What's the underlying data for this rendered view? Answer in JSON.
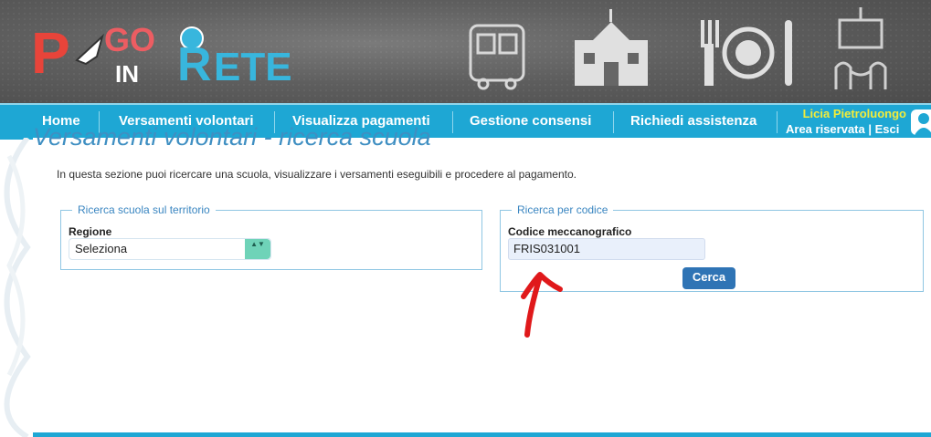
{
  "header": {
    "logo_text_1": "P",
    "logo_text_2": "GO",
    "logo_text_3": "IN",
    "logo_text_4": "R",
    "logo_text_5": "ETE"
  },
  "nav": {
    "items": [
      {
        "label": "Home"
      },
      {
        "label": "Versamenti volontari"
      },
      {
        "label": "Visualizza pagamenti"
      },
      {
        "label": "Gestione consensi"
      },
      {
        "label": "Richiedi assistenza"
      }
    ],
    "user_name": "Licia Pietroluongo",
    "reserved_area": "Area riservata",
    "separator": "|",
    "logout": "Esci"
  },
  "page": {
    "title": "Versamenti volontari - ricerca scuola",
    "intro": "In questa sezione puoi ricercare una scuola, visualizzare i versamenti eseguibili e procedere al pagamento."
  },
  "territory_search": {
    "legend": "Ricerca scuola sul territorio",
    "region_label": "Regione",
    "region_value": "Seleziona"
  },
  "code_search": {
    "legend": "Ricerca per codice",
    "code_label": "Codice meccanografico",
    "code_value": "FRIS031001",
    "search_button": "Cerca"
  },
  "colors": {
    "nav_bg": "#1ea7d4",
    "user_name": "#f3ec3a",
    "button": "#2f74b5",
    "annotation_arrow": "#e0191b"
  }
}
